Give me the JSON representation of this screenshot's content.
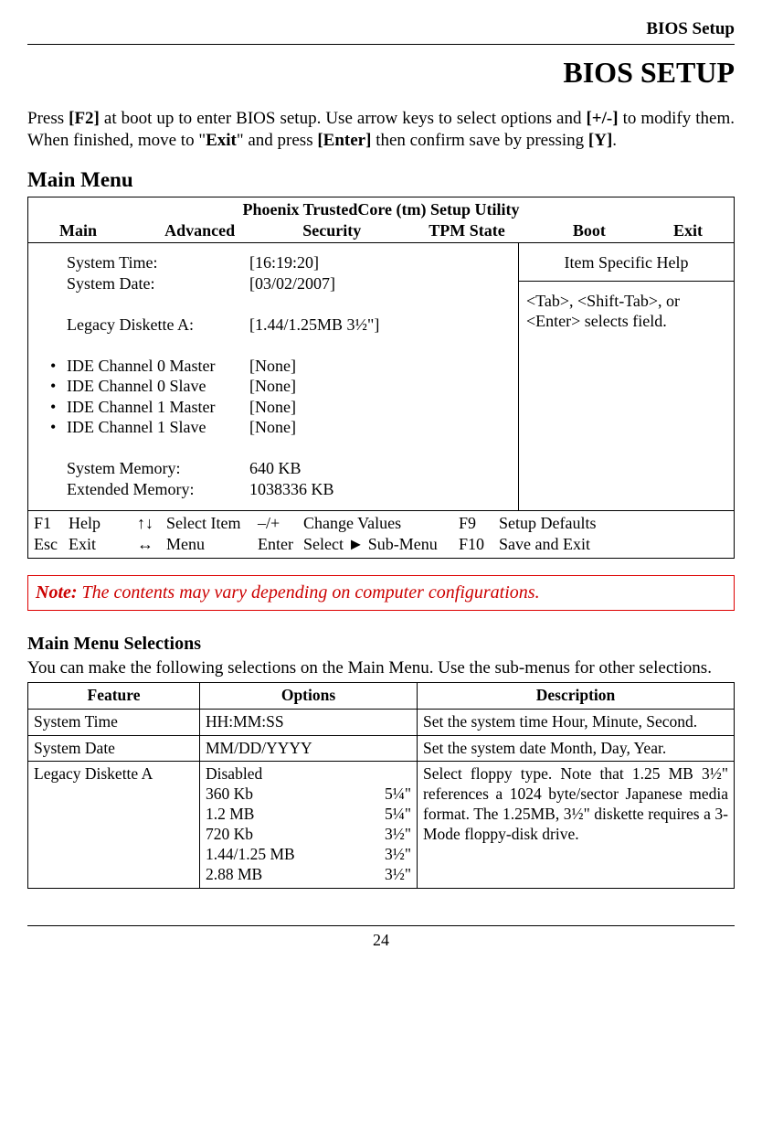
{
  "header": {
    "section": "BIOS Setup"
  },
  "title": "BIOS SETUP",
  "intro_parts": {
    "p1": "Press ",
    "k1": "[F2]",
    "p2": " at boot up to enter BIOS setup. Use arrow keys to select options and ",
    "k2": "[+/-]",
    "p3": " to modify them. When finished, move to \"",
    "k3": "Exit",
    "p4": "\" and press ",
    "k4": "[Enter]",
    "p5": " then confirm save by pressing ",
    "k5": "[Y]",
    "p6": "."
  },
  "main_menu_heading": "Main Menu",
  "bios": {
    "utility_title": "Phoenix TrustedCore (tm) Setup Utility",
    "tabs": [
      "Main",
      "Advanced",
      "Security",
      "TPM State",
      "Boot",
      "Exit"
    ],
    "items": [
      {
        "bullet": "",
        "label": "System Time:",
        "value": "[16:19:20]"
      },
      {
        "bullet": "",
        "label": "System Date:",
        "value": "[03/02/2007]"
      },
      {
        "bullet": "",
        "label": "",
        "value": ""
      },
      {
        "bullet": "",
        "label": "Legacy Diskette A:",
        "value": "[1.44/1.25MB 3½\"]"
      },
      {
        "bullet": "",
        "label": "",
        "value": ""
      },
      {
        "bullet": "•",
        "label": "IDE Channel 0 Master",
        "value": "[None]"
      },
      {
        "bullet": "•",
        "label": "IDE Channel 0 Slave",
        "value": "[None]"
      },
      {
        "bullet": "•",
        "label": "IDE Channel 1 Master",
        "value": "[None]"
      },
      {
        "bullet": "•",
        "label": "IDE Channel 1 Slave",
        "value": "[None]"
      },
      {
        "bullet": "",
        "label": "",
        "value": ""
      },
      {
        "bullet": "",
        "label": "System Memory:",
        "value": "640 KB"
      },
      {
        "bullet": "",
        "label": "Extended Memory:",
        "value": "1038336 KB"
      }
    ],
    "help": {
      "title": "Item Specific Help",
      "body": "<Tab>, <Shift-Tab>, or <Enter> selects field."
    },
    "footer": {
      "r1": {
        "k1": "F1",
        "d1": "Help",
        "sym": "↑↓",
        "arrow": "Select Item",
        "k2": "–/+",
        "d2": "Change Values",
        "k3": "F9",
        "d3": "Setup Defaults"
      },
      "r2": {
        "k1": "Esc",
        "d1": "Exit",
        "sym": "↔",
        "arrow": "Menu",
        "k2": "Enter",
        "d2": "Select ► Sub-Menu",
        "k3": "F10",
        "d3": "Save and Exit"
      }
    }
  },
  "note": {
    "label": "Note:",
    "text": " The contents may vary depending on computer configurations."
  },
  "selections": {
    "heading": "Main Menu Selections",
    "intro": "You can make the following selections on the Main Menu. Use the sub-menus for other selections.",
    "columns": [
      "Feature",
      "Options",
      "Description"
    ],
    "rows": [
      {
        "feature": "System Time",
        "options": [
          {
            "name": "HH:MM:SS",
            "size": ""
          }
        ],
        "description": "Set the system time Hour, Minute, Second."
      },
      {
        "feature": "System Date",
        "options": [
          {
            "name": "MM/DD/YYYY",
            "size": ""
          }
        ],
        "description": "Set the system date Month, Day, Year."
      },
      {
        "feature": "Legacy Diskette A",
        "options": [
          {
            "name": "Disabled",
            "size": ""
          },
          {
            "name": "360 Kb",
            "size": "5¼\""
          },
          {
            "name": "1.2 MB",
            "size": "5¼\""
          },
          {
            "name": "720 Kb",
            "size": "3½\""
          },
          {
            "name": "1.44/1.25 MB",
            "size": "3½\""
          },
          {
            "name": "2.88 MB",
            "size": "3½\""
          }
        ],
        "description": "Select floppy type. Note that 1.25 MB 3½\" references a 1024 byte/sector Japanese media format. The 1.25MB, 3½\" diskette requires a 3-Mode floppy-disk drive."
      }
    ]
  },
  "page_number": "24"
}
